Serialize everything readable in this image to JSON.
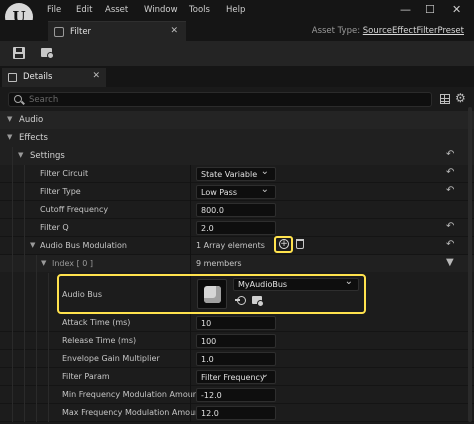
{
  "menubar": {
    "logo_letter": "U",
    "items": [
      "File",
      "Edit",
      "Asset",
      "Window",
      "Tools",
      "Help"
    ],
    "window_controls": {
      "minimize": "—",
      "maximize": "☐",
      "close": "✕"
    }
  },
  "tab": {
    "label": "Filter",
    "close": "✕"
  },
  "asset_type": {
    "prefix": "Asset Type:",
    "value": "SourceEffectFilterPreset"
  },
  "details_tab": {
    "label": "Details",
    "close": "✕"
  },
  "search": {
    "placeholder": "Search"
  },
  "icons": {
    "gear": "⚙",
    "reset": "↶",
    "chevron_down": "▼",
    "chevron_right": "▶"
  },
  "colors": {
    "highlight": "#ffe24d",
    "panel_bg": "#1a1a1a",
    "category_bg": "#242424"
  },
  "categories": {
    "audio": "Audio",
    "effects": "Effects",
    "settings": "Settings"
  },
  "properties": {
    "filter_circuit": {
      "label": "Filter Circuit",
      "value": "State Variable"
    },
    "filter_type": {
      "label": "Filter Type",
      "value": "Low Pass"
    },
    "cutoff_frequency": {
      "label": "Cutoff Frequency",
      "value": "800.0"
    },
    "filter_q": {
      "label": "Filter Q",
      "value": "2.0"
    },
    "audio_bus_modulation": {
      "label": "Audio Bus Modulation",
      "value": "1 Array elements",
      "add": "+"
    },
    "index0": {
      "label": "Index [ 0 ]",
      "value": "9 members"
    },
    "audio_bus": {
      "label": "Audio Bus",
      "asset": "MyAudioBus"
    },
    "attack_time": {
      "label": "Attack Time (ms)",
      "value": "10"
    },
    "release_time": {
      "label": "Release Time (ms)",
      "value": "100"
    },
    "envelope_gain": {
      "label": "Envelope Gain Multiplier",
      "value": "1.0"
    },
    "filter_param": {
      "label": "Filter Param",
      "value": "Filter Frequency"
    },
    "min_freq_mod": {
      "label": "Min Frequency Modulation Amount",
      "value": "-12.0"
    },
    "max_freq_mod": {
      "label": "Max Frequency Modulation Amount",
      "value": "12.0"
    }
  }
}
